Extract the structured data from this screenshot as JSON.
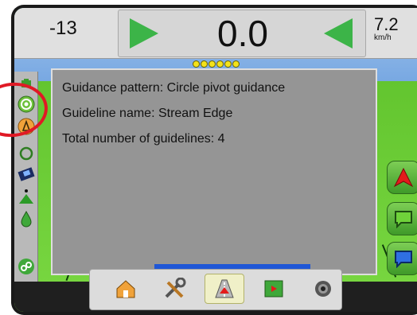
{
  "status": {
    "left_value": "-13",
    "cross_track": "0.0",
    "speed": "7.2",
    "speed_unit": "km/h"
  },
  "lightbar": {
    "lit_count": 6
  },
  "guidance_info": {
    "pattern_line": "Guidance pattern: Circle pivot guidance",
    "guideline_line": "Guideline name: Stream Edge",
    "total_line": "Total number of guidelines: 4"
  },
  "left_toolbar_icons": [
    "vehicle-icon",
    "pivot-circle-icon",
    "guideline-icon",
    "steering-icon",
    "vehicle-view-icon",
    "mark-point-icon",
    "application-icon",
    "link-icon"
  ],
  "right_buttons": [
    "guidance-arrow-icon",
    "green-panel-icon",
    "blue-panel-icon"
  ],
  "bottom_tabs": [
    "home-icon",
    "tools-icon",
    "guidance-icon",
    "mapping-icon",
    "camera-icon"
  ],
  "colors": {
    "guidance_green": "#3cb448",
    "lightbar_yellow": "#f3e21a",
    "annotation_red": "#e01925",
    "panel_gray": "#959595"
  }
}
